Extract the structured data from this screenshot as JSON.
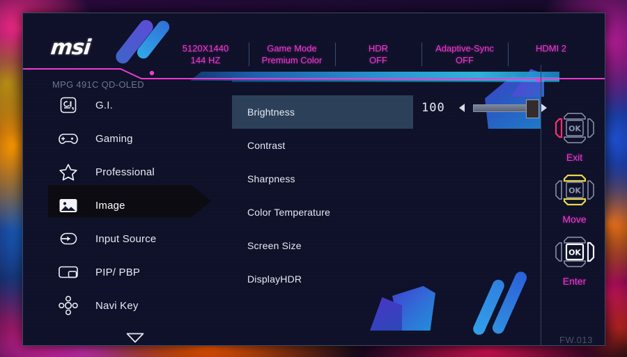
{
  "osd": {
    "brand_logo": "msi",
    "model_name": "MPG 491C QD-OLED",
    "firmware": "FW.013",
    "status_items": [
      {
        "line1": "5120X1440",
        "line2": "144 HZ"
      },
      {
        "line1": "Game Mode",
        "line2": "Premium Color"
      },
      {
        "line1": "HDR",
        "line2": "OFF"
      },
      {
        "line1": "Adaptive-Sync",
        "line2": "OFF"
      },
      {
        "line1": "HDMI 2",
        "line2": ""
      }
    ],
    "sidebar": {
      "items": [
        {
          "label": "G.I.",
          "icon": "gi-icon",
          "selected": false
        },
        {
          "label": "Gaming",
          "icon": "gamepad-icon",
          "selected": false
        },
        {
          "label": "Professional",
          "icon": "star-icon",
          "selected": false
        },
        {
          "label": "Image",
          "icon": "picture-icon",
          "selected": true
        },
        {
          "label": "Input Source",
          "icon": "input-arrow-icon",
          "selected": false
        },
        {
          "label": "PIP/ PBP",
          "icon": "pip-pbp-icon",
          "selected": false
        },
        {
          "label": "Navi Key",
          "icon": "navi-key-icon",
          "selected": false
        }
      ],
      "scroll_more_icon": "chevron-down-icon"
    },
    "menu": {
      "items": [
        {
          "label": "Brightness",
          "active": true
        },
        {
          "label": "Contrast",
          "active": false
        },
        {
          "label": "Sharpness",
          "active": false
        },
        {
          "label": "Color Temperature",
          "active": false
        },
        {
          "label": "Screen Size",
          "active": false
        },
        {
          "label": "DisplayHDR",
          "active": false
        }
      ]
    },
    "slider": {
      "value": "100",
      "percent": 100,
      "dec_icon": "triangle-left-icon",
      "inc_icon": "triangle-right-icon"
    },
    "controls": [
      {
        "label": "Exit",
        "icon": "dpad-left-icon"
      },
      {
        "label": "Move",
        "icon": "dpad-updown-icon"
      },
      {
        "label": "Enter",
        "icon": "dpad-ok-icon"
      }
    ],
    "colors": {
      "accent_magenta": "#ef3ad0",
      "accent_cyan": "#3fd8f0",
      "panel_bg": "#0d1028",
      "row_highlight": "#2b3f59",
      "muted_text": "#6d7792"
    }
  }
}
